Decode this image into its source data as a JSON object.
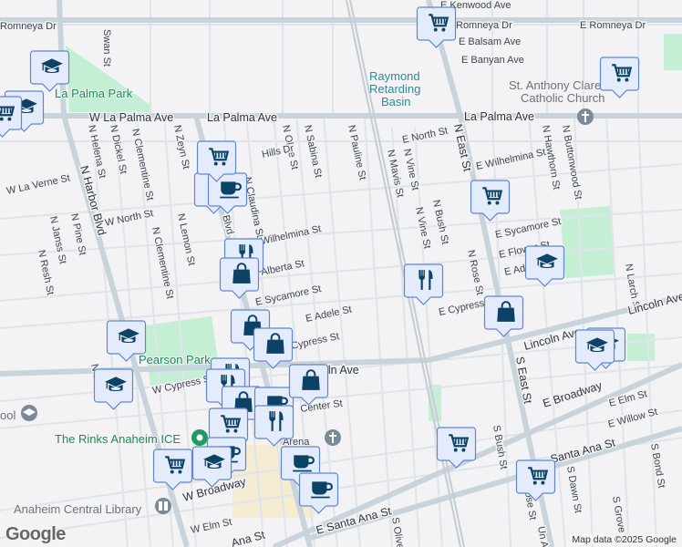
{
  "parks": {
    "la_palma": "La Palma Park",
    "pearson": "Pearson Park"
  },
  "water": {
    "line1": "Raymond",
    "line2": "Retarding",
    "line3": "Basin"
  },
  "poi": {
    "church_l1": "St. Anthony Claret",
    "church_l2": "Catholic Church",
    "rinks": "The Rinks Anaheim ICE",
    "library": "Anaheim Central Library",
    "arena": "Arena",
    "school_partial": "ool"
  },
  "streets": {
    "romneya_w": "Romneya Dr",
    "romneya_mid": "Romneya Dr",
    "romneya_e": "E Romneya Dr",
    "kenwood": "E Kenwood Ave",
    "balsam": "E Balsam Ave",
    "banyan": "E Banyan Ave",
    "swan": "Swan St",
    "w_la_palma": "W La Palma Ave",
    "la_palma": "La Palma Ave",
    "la_palma_e": "La Palma Ave",
    "helena": "N Helena St",
    "dickel": "N Dickel St",
    "clementine": "N Clementine St",
    "clementine2": "N Clementine St",
    "zeyn": "N Zeyn St",
    "olive": "N Olive St",
    "sabina": "N Sabina St",
    "pauline": "N Pauline St",
    "mavis": "N Mavis St",
    "vine": "N Vine St",
    "vine2": "N Vine St",
    "bush": "N Bush St",
    "rose": "N Rose St",
    "east": "N East St",
    "hawthorn": "N Hawthorn St",
    "buttonwood": "N Buttonwood St",
    "larch": "N Larch St",
    "harbor": "N Harbor Blvd",
    "la_verne": "W La Verne St",
    "w_north": "W North St",
    "e_north": "E North St",
    "lemon": "N Lemon St",
    "janss": "N Janss St",
    "pine": "N Pine St",
    "resh": "N Resh St",
    "claudina": "N Claudina St",
    "wilhelmina": "Wilhelmina St",
    "e_wilhelmina": "E Wilhelmina St",
    "hills": "Hills Dr",
    "alberta": "Alberta St",
    "e_sycamore": "E Sycamore St",
    "e_sycamore2": "E Sycamore St",
    "e_adele": "E Adele St",
    "e_adele2": "E Adele St",
    "e_flower": "E Flower St",
    "e_cypress": "E Cypress St",
    "cypress": "Cypress St",
    "w_cypress": "W Cypress St",
    "blvd": "Blvd",
    "lincoln": "Lincoln Ave",
    "lincoln_e": "Lincoln Ave",
    "lincoln_e2": "Lincoln Ave",
    "center": "Center St",
    "e_broadway": "E Broadway",
    "w_broadway": "W Broadway",
    "e_elm": "E Elm St",
    "e_willow": "E Willow St",
    "santa_ana": "Santa Ana St",
    "e_santa_ana": "E Santa Ana St",
    "santa_ana_w": "Ana St",
    "w_elm": "W Elm St",
    "s_east": "S East St",
    "s_bush": "S Bush St",
    "s_dawn": "S Dawn St",
    "s_bond": "S Bond St",
    "s_grove": "S Grove",
    "s_olive": "S Olive",
    "s_rose": "ose St",
    "un": "Un A",
    "jans_partial": "N Jans"
  },
  "markers": [
    "grocery",
    "school",
    "school",
    "grocery",
    "grocery",
    "grocery",
    "restaurant",
    "cafe",
    "grocery",
    "restaurant",
    "shopping",
    "school",
    "restaurant",
    "shopping",
    "shopping",
    "shopping",
    "school",
    "school",
    "school",
    "school",
    "restaurant",
    "restaurant",
    "shopping",
    "cafe",
    "shopping",
    "grocery",
    "restaurant",
    "cafe",
    "school",
    "grocery",
    "cafe",
    "cafe",
    "grocery",
    "grocery"
  ],
  "footer": {
    "logo": "Google",
    "credit": "Map data ©2025 Google"
  },
  "colors": {
    "marker_icon": "#0b4266",
    "marker_bg": "#e4ecfb",
    "park": "#c5efd4"
  }
}
